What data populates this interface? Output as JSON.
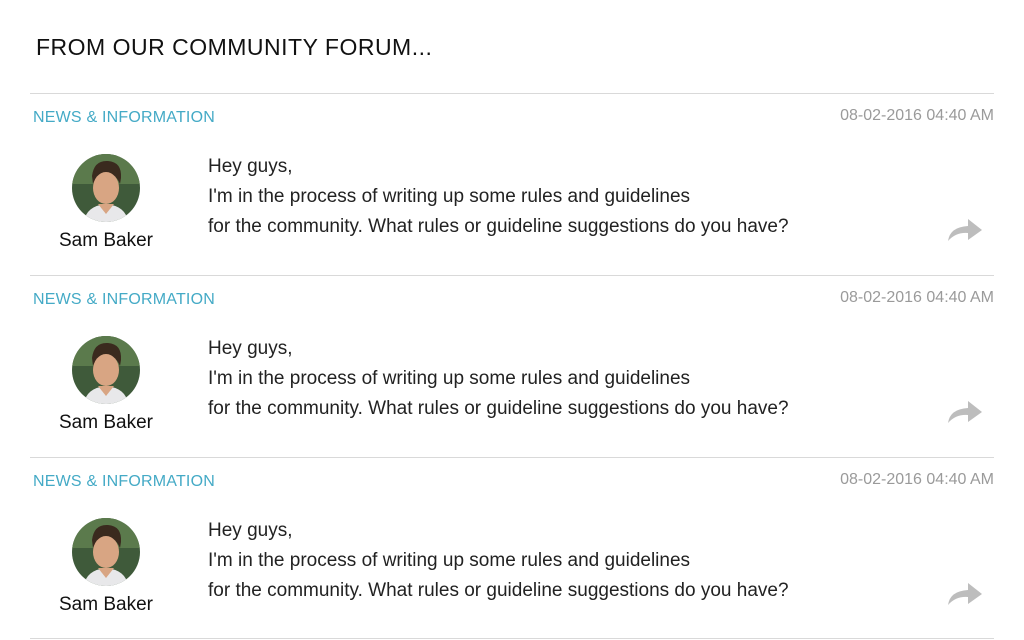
{
  "header": {
    "title": "FROM OUR COMMUNITY FORUM..."
  },
  "posts": [
    {
      "category": "NEWS & INFORMATION",
      "timestamp": "08-02-2016 04:40 AM",
      "author": "Sam Baker",
      "lines": [
        "Hey guys,",
        "I'm in the process of writing up some rules and guidelines",
        "for the community. What rules or guideline suggestions do you have?"
      ]
    },
    {
      "category": "NEWS & INFORMATION",
      "timestamp": "08-02-2016 04:40 AM",
      "author": "Sam Baker",
      "lines": [
        "Hey guys,",
        "I'm in the process of writing up some rules and guidelines",
        "for the community. What rules or guideline suggestions do you have?"
      ]
    },
    {
      "category": "NEWS & INFORMATION",
      "timestamp": "08-02-2016 04:40 AM",
      "author": "Sam Baker",
      "lines": [
        "Hey guys,",
        "I'm in the process of writing up some rules and guidelines",
        "for the community. What rules or guideline suggestions do you have?"
      ]
    }
  ],
  "colors": {
    "category": "#44aac6",
    "timestamp": "#9a9a9a",
    "divider": "#d9d9d9",
    "share_icon": "#bdbdbd"
  },
  "icons": {
    "share": "share-arrow-icon",
    "avatar": "user-avatar"
  }
}
